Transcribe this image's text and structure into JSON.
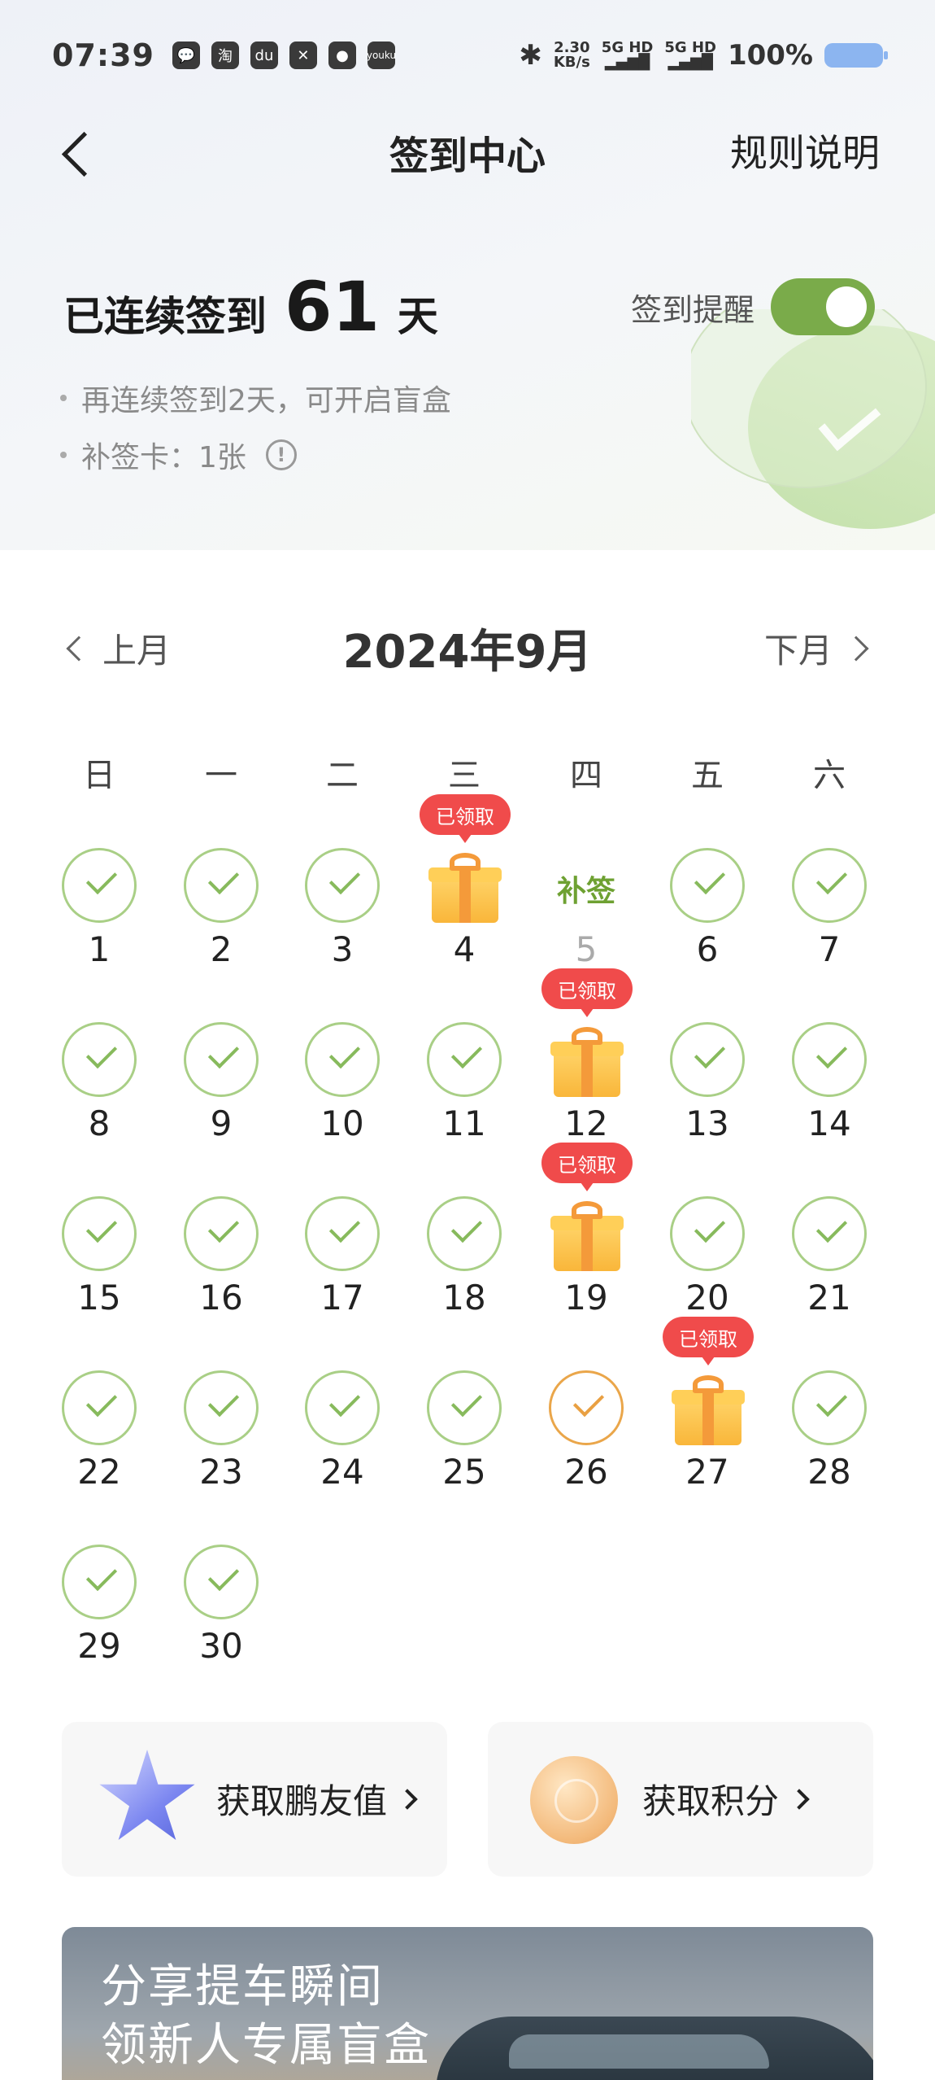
{
  "status_bar": {
    "time": "07:39",
    "apps": [
      "💬",
      "淘",
      "du",
      "✕",
      "●",
      "youku"
    ],
    "net_speed": "2.30",
    "net_unit": "KB/s",
    "sig1": "5G HD",
    "sig2": "5G HD",
    "battery": "100%"
  },
  "header": {
    "title": "签到中心",
    "rules": "规则说明"
  },
  "streak": {
    "prefix": "已连续签到",
    "days": "61",
    "unit": "天",
    "reminder_label": "签到提醒",
    "reminder_on": true,
    "bullet1": "再连续签到2天，可开启盲盒",
    "bullet2": "补签卡：1张",
    "info_glyph": "!"
  },
  "calendar": {
    "month_label": "2024年9月",
    "prev": "上月",
    "next": "下月",
    "weekdays": [
      "日",
      "一",
      "二",
      "三",
      "四",
      "五",
      "六"
    ],
    "makeup_label": "补签",
    "badge_label": "已领取",
    "days": [
      {
        "d": "1"
      },
      {
        "d": "2"
      },
      {
        "d": "3"
      },
      {
        "d": "4"
      },
      {
        "d": "5"
      },
      {
        "d": "6"
      },
      {
        "d": "7"
      },
      {
        "d": "8"
      },
      {
        "d": "9"
      },
      {
        "d": "10"
      },
      {
        "d": "11"
      },
      {
        "d": "12"
      },
      {
        "d": "13"
      },
      {
        "d": "14"
      },
      {
        "d": "15"
      },
      {
        "d": "16"
      },
      {
        "d": "17"
      },
      {
        "d": "18"
      },
      {
        "d": "19"
      },
      {
        "d": "20"
      },
      {
        "d": "21"
      },
      {
        "d": "22"
      },
      {
        "d": "23"
      },
      {
        "d": "24"
      },
      {
        "d": "25"
      },
      {
        "d": "26"
      },
      {
        "d": "27"
      },
      {
        "d": "28"
      },
      {
        "d": "29"
      },
      {
        "d": "30"
      }
    ]
  },
  "cards": {
    "left": "获取鹏友值",
    "right": "获取积分"
  },
  "banner": {
    "line1": "分享提车瞬间",
    "line2": "领新人专属盲盒"
  },
  "colors": {
    "accent_green": "#7aab4a",
    "check_green": "#87ba5c",
    "today_orange": "#eaa64a",
    "badge_red": "#f04b4b"
  }
}
